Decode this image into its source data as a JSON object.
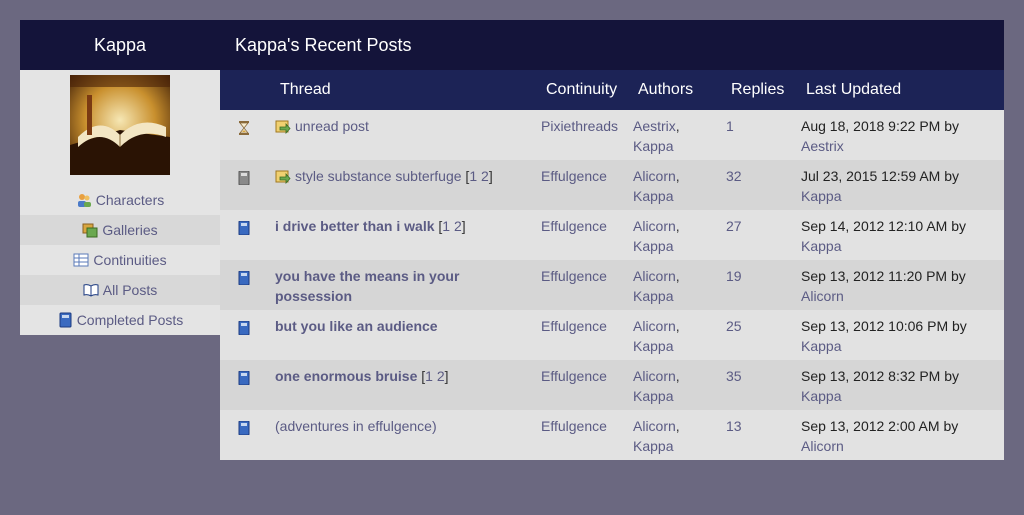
{
  "sidebar": {
    "title": "Kappa",
    "items": [
      {
        "label": "Characters",
        "icon": "characters-icon"
      },
      {
        "label": "Galleries",
        "icon": "galleries-icon"
      },
      {
        "label": "Continuities",
        "icon": "continuities-icon"
      },
      {
        "label": "All Posts",
        "icon": "book-open-icon"
      },
      {
        "label": "Completed Posts",
        "icon": "book-closed-icon"
      }
    ]
  },
  "main": {
    "title": "Kappa's Recent Posts",
    "columns": {
      "thread": "Thread",
      "continuity": "Continuity",
      "authors": "Authors",
      "replies": "Replies",
      "updated": "Last Updated"
    },
    "rows": [
      {
        "status": "hourglass",
        "title": "unread post",
        "new": true,
        "bold": false,
        "pages": [],
        "continuity": "Pixiethreads",
        "author1": "Aestrix",
        "author2": "Kappa",
        "replies": "1",
        "updated": "Aug 18, 2018 9:22 PM by",
        "by": "Aestrix"
      },
      {
        "status": "grey-book",
        "title": "style substance subterfuge",
        "new": true,
        "bold": false,
        "pages": [
          "1",
          "2"
        ],
        "continuity": "Effulgence",
        "author1": "Alicorn",
        "author2": "Kappa",
        "replies": "32",
        "updated": "Jul 23, 2015 12:59 AM by",
        "by": "Kappa"
      },
      {
        "status": "blue-book",
        "title": "i drive better than i walk",
        "new": false,
        "bold": true,
        "pages": [
          "1",
          "2"
        ],
        "continuity": "Effulgence",
        "author1": "Alicorn",
        "author2": "Kappa",
        "replies": "27",
        "updated": "Sep 14, 2012 12:10 AM by",
        "by": "Kappa"
      },
      {
        "status": "blue-book",
        "title": "you have the means in your possession",
        "new": false,
        "bold": true,
        "pages": [],
        "continuity": "Effulgence",
        "author1": "Alicorn",
        "author2": "Kappa",
        "replies": "19",
        "updated": "Sep 13, 2012 11:20 PM by",
        "by": "Alicorn"
      },
      {
        "status": "blue-book",
        "title": "but you like an audience",
        "new": false,
        "bold": true,
        "pages": [],
        "continuity": "Effulgence",
        "author1": "Alicorn",
        "author2": "Kappa",
        "replies": "25",
        "updated": "Sep 13, 2012 10:06 PM by",
        "by": "Kappa"
      },
      {
        "status": "blue-book",
        "title": "one enormous bruise",
        "new": false,
        "bold": true,
        "pages": [
          "1",
          "2"
        ],
        "continuity": "Effulgence",
        "author1": "Alicorn",
        "author2": "Kappa",
        "replies": "35",
        "updated": "Sep 13, 2012 8:32 PM by",
        "by": "Kappa"
      },
      {
        "status": "blue-book",
        "title": "(adventures in effulgence)",
        "new": false,
        "bold": false,
        "pages": [],
        "continuity": "Effulgence",
        "author1": "Alicorn",
        "author2": "Kappa",
        "replies": "13",
        "updated": "Sep 13, 2012 2:00 AM by",
        "by": "Alicorn"
      }
    ]
  }
}
